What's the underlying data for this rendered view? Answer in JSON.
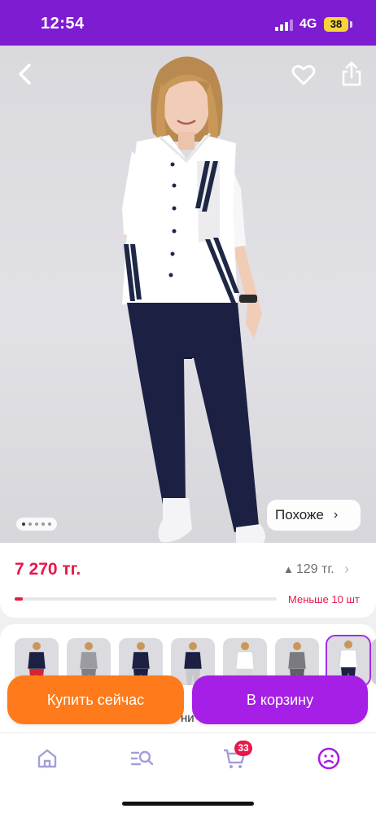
{
  "status_bar": {
    "time": "12:54",
    "network": "4G",
    "battery": "38"
  },
  "hero": {
    "image_description_icon": "product-photo",
    "carousel": {
      "count": 5,
      "active_index": 0
    },
    "similar_label": "Похоже",
    "similar_chevron": "›"
  },
  "price_card": {
    "price": "7 270 тг.",
    "old_price_delta": "129 тг.",
    "delta_icon": "▲",
    "chevron": "›",
    "stock_label": "Меньше 10 шт",
    "stock_fraction": 0.03
  },
  "variants": {
    "thumbnail_count": 7,
    "selected_index": 6,
    "label_partial": "ни"
  },
  "actions": {
    "buy_now": "Купить сейчас",
    "add_to_cart": "В корзину"
  },
  "nav": {
    "cart_count": "33"
  },
  "colors": {
    "brand": "#7e1cd1",
    "price": "#e8174a",
    "buy": "#ff7a1a",
    "cart": "#a51fe6"
  }
}
